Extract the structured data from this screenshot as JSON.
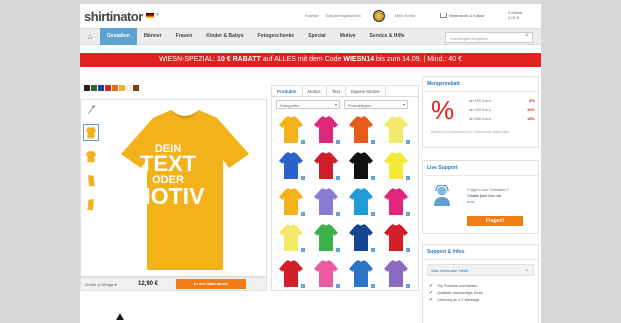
{
  "header": {
    "logo": "shirtinator",
    "lang_dropdown": "▾",
    "links": [
      "Kontakt",
      "Geschenkgutschein"
    ],
    "my_account": "Mein Konto",
    "cart_label": "Warenkorb & Kasse",
    "total_label": "0 Artikel",
    "total_value": "0,00 €"
  },
  "nav": {
    "items": [
      "Gestalten",
      "Männer",
      "Frauen",
      "Kinder & Babys",
      "Fotogeschenke",
      "Special",
      "Motive",
      "Service & Hilfe"
    ],
    "search_placeholder": "Suchbegriff eingeben"
  },
  "promo": {
    "pre": "WIESN-SPEZIAL: ",
    "discount": "10 € RABATT",
    "mid": " auf ALLES mit dem Code ",
    "code": "WIESN14",
    "post": " bis zum 14.09. | Mind.: 40 €"
  },
  "colors": {
    "swatches": [
      "#222222",
      "#2b6a2b",
      "#1d3f8a",
      "#cc2222",
      "#e07010",
      "#f3b21a",
      "#f4f4f4",
      "#7a3e1a"
    ],
    "accent": "#5fa1d0",
    "promo": "#e41f1f",
    "cta": "#f07c16",
    "shirt": "#f3b21a"
  },
  "designer": {
    "shirt_lines": [
      "DEIN",
      "TEXT",
      "ODER",
      "MOTIV"
    ],
    "size_label": "Größe & Menge ▾",
    "price": "12,90 €",
    "cart_button": "In den Warenkorb"
  },
  "catalog": {
    "tabs": [
      "Produkte",
      "Motive",
      "Text",
      "Eigene Motive"
    ],
    "filter1": "Kategorien",
    "filter2": "Produkttypen",
    "shirts": [
      "#f3b21a",
      "#e0267a",
      "#e85a1a",
      "#f2eb6a",
      "#2a62c9",
      "#cf1f2a",
      "#111111",
      "#f4e838",
      "#f3b21a",
      "#8a7bd3",
      "#1e9bd8",
      "#e0267a",
      "#f2eb6a",
      "#3cb24a",
      "#14458f",
      "#d21f2a",
      "#d21f2a",
      "#ee5aa0",
      "#2b73c6",
      "#8b6bbf"
    ],
    "info": "i"
  },
  "discount": {
    "title": "Mengenrabatt",
    "symbol": "%",
    "tiers": [
      {
        "label": "ab 100 Euro",
        "value": "5%"
      },
      {
        "label": "ab 250 Euro",
        "value": "10%"
      },
      {
        "label": "ab 500 Euro",
        "value": "15%"
      }
    ],
    "note": "Rabatt wird automatisch im Warenkorb abgezogen"
  },
  "support": {
    "title": "Live Support",
    "question": "Fragen zum Gestalten?",
    "chat": "Chatte jetzt live mit",
    "link": "uns!",
    "button": "Fragen!"
  },
  "infos": {
    "title": "Support & Infos",
    "bar": "Was shirtinator bietet",
    "checks": [
      "Top Produkte und Marken",
      "Qualitativ hochwertiger Druck",
      "Lieferung ca. 4-7 Werktage"
    ]
  }
}
